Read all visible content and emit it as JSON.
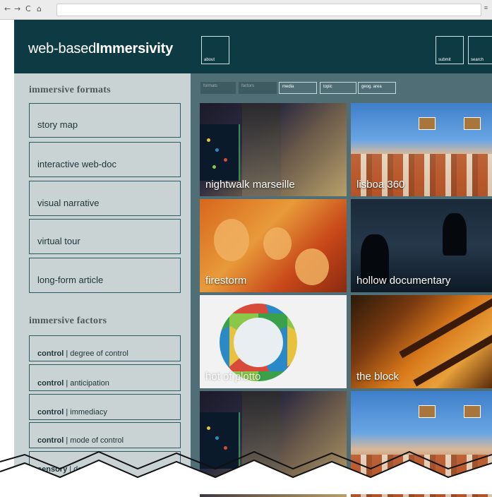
{
  "header": {
    "logo_light": "web-based",
    "logo_bold": "Immersivity",
    "buttons": {
      "about": "about",
      "submit": "submit",
      "search": "search"
    }
  },
  "sidebar": {
    "formats_title": "immersive formats",
    "formats": [
      "story map",
      "interactive web-doc",
      "visual narrative",
      "virtual tour",
      "long-form article"
    ],
    "factors_title": "immersive factors",
    "factors": [
      {
        "bold": "control",
        "rest": " | degree of control"
      },
      {
        "bold": "control",
        "rest": " | anticipation"
      },
      {
        "bold": "control",
        "rest": " | immediacy"
      },
      {
        "bold": "control",
        "rest": " | mode of control"
      },
      {
        "bold": "sensory",
        "rest": " | depth"
      }
    ]
  },
  "filters": [
    "formats",
    "factors",
    "media",
    "topic",
    "geog. area"
  ],
  "tiles": [
    "nightwalk marseille",
    "lisboa 360",
    "firestorm",
    "hollow documentary",
    "hot of plotto",
    "the block"
  ],
  "colors": {
    "header": "#0e3b43",
    "sidebar": "#c9d3d4",
    "main": "#4f6e76",
    "accent": "#2d5a60"
  }
}
